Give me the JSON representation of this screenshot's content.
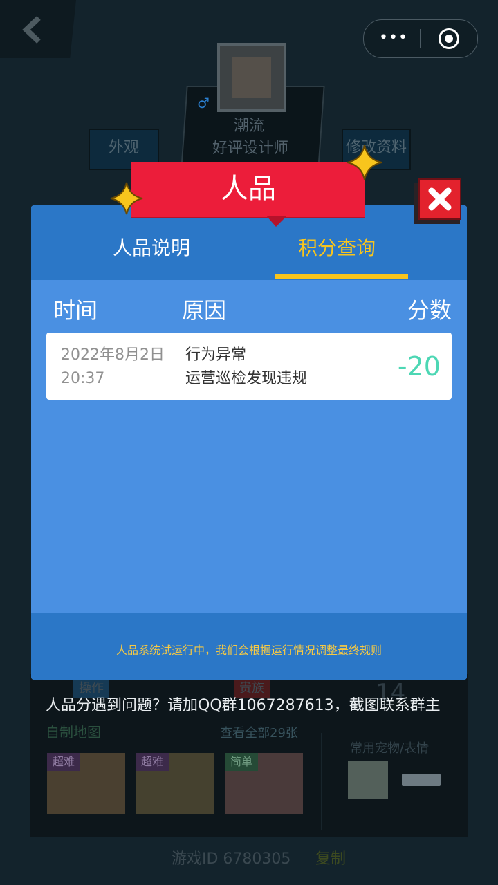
{
  "background": {
    "profile": {
      "title": "潮流",
      "subtitle": "好评设计师",
      "gender_icon": "male-symbol"
    },
    "buttons": {
      "appearance": "外观",
      "edit_profile": "修改资料"
    },
    "tags": {
      "operation": "操作",
      "noble": "贵族"
    },
    "big_number": "14",
    "problem_text": "人品分遇到问题？请加QQ群1067287613，截图联系群主",
    "custom_maps": {
      "title": "自制地图",
      "view_all": "查看全部29张"
    },
    "thumbnails": [
      {
        "tag": "超难"
      },
      {
        "tag": "超难"
      },
      {
        "tag": "简单"
      }
    ],
    "pet_label": "常用宠物/表情",
    "game_id": "游戏ID 6780305",
    "copy": "复制"
  },
  "modal": {
    "title": "人品",
    "tabs": [
      {
        "label": "人品说明",
        "active": false
      },
      {
        "label": "积分查询",
        "active": true
      }
    ],
    "columns": {
      "time": "时间",
      "reason": "原因",
      "score": "分数"
    },
    "records": [
      {
        "date": "2022年8月2日",
        "time": "20:37",
        "reason_line1": "行为异常",
        "reason_line2": "运营巡检发现违规",
        "score": "-20"
      }
    ],
    "footer": "人品系统试运行中，我们会根据运行情况调整最终规则"
  },
  "colors": {
    "modal_bg": "#4a90e2",
    "header_bg": "#2b77c7",
    "accent_yellow": "#f8c51d",
    "ribbon_red": "#ec1d3a",
    "score_green": "#4dd7b4"
  }
}
